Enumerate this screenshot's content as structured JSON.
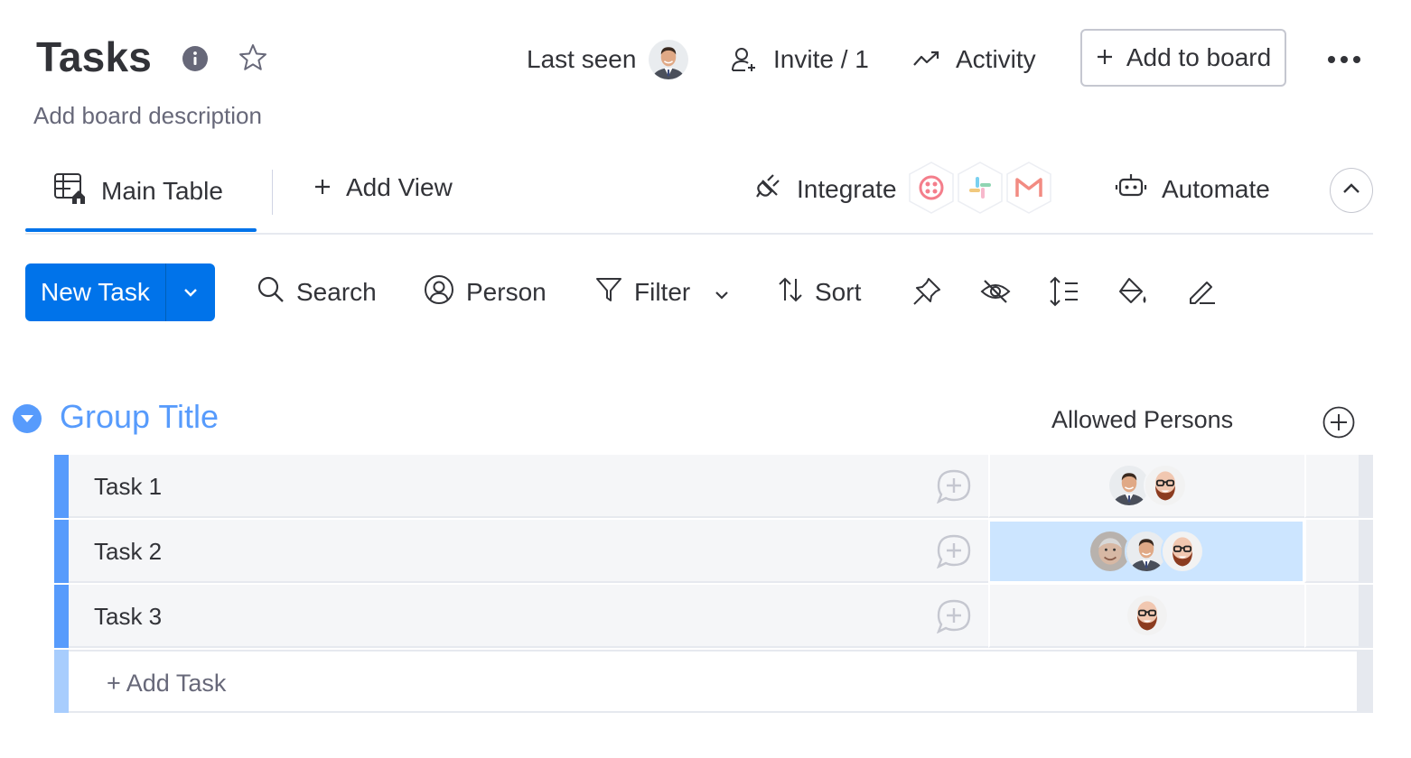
{
  "board": {
    "title": "Tasks",
    "description": "Add board description"
  },
  "header": {
    "last_seen_label": "Last seen",
    "invite_label": "Invite / 1",
    "activity_label": "Activity",
    "add_to_board_label": "Add to board"
  },
  "views": {
    "main_table_label": "Main Table",
    "add_view_label": "Add View",
    "integrate_label": "Integrate",
    "automate_label": "Automate",
    "integration_icons": [
      "twilio-icon",
      "slack-icon",
      "gmail-icon"
    ]
  },
  "toolbar": {
    "new_task_label": "New Task",
    "search_label": "Search",
    "person_label": "Person",
    "filter_label": "Filter",
    "sort_label": "Sort"
  },
  "group": {
    "title": "Group Title",
    "column_header": "Allowed Persons",
    "color": "#579bfc",
    "tasks": [
      {
        "name": "Task 1",
        "persons": [
          "person-suit",
          "person-bald-beard"
        ]
      },
      {
        "name": "Task 2",
        "persons": [
          "person-grey",
          "person-suit",
          "person-bald-beard"
        ],
        "selected": true
      },
      {
        "name": "Task 3",
        "persons": [
          "person-bald-beard"
        ]
      }
    ],
    "add_task_label": "+ Add Task"
  },
  "colors": {
    "primary": "#0073ea",
    "group": "#579bfc",
    "selected_cell": "#cce5ff",
    "row_bg": "#f5f6f8"
  }
}
